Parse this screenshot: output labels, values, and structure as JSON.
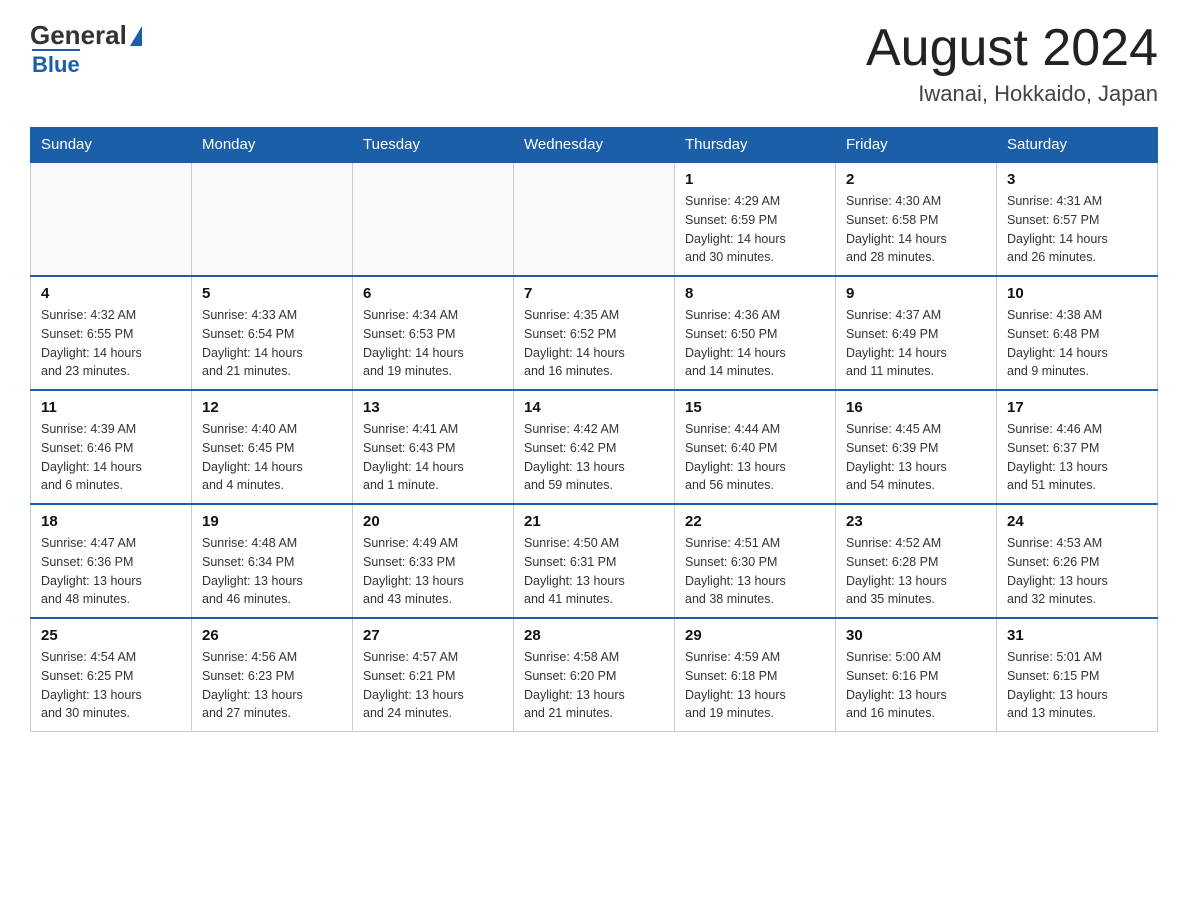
{
  "logo": {
    "general": "General",
    "arrow": "▶",
    "blue": "Blue"
  },
  "header": {
    "title": "August 2024",
    "subtitle": "Iwanai, Hokkaido, Japan"
  },
  "weekdays": [
    "Sunday",
    "Monday",
    "Tuesday",
    "Wednesday",
    "Thursday",
    "Friday",
    "Saturday"
  ],
  "weeks": [
    [
      {
        "day": "",
        "info": ""
      },
      {
        "day": "",
        "info": ""
      },
      {
        "day": "",
        "info": ""
      },
      {
        "day": "",
        "info": ""
      },
      {
        "day": "1",
        "info": "Sunrise: 4:29 AM\nSunset: 6:59 PM\nDaylight: 14 hours\nand 30 minutes."
      },
      {
        "day": "2",
        "info": "Sunrise: 4:30 AM\nSunset: 6:58 PM\nDaylight: 14 hours\nand 28 minutes."
      },
      {
        "day": "3",
        "info": "Sunrise: 4:31 AM\nSunset: 6:57 PM\nDaylight: 14 hours\nand 26 minutes."
      }
    ],
    [
      {
        "day": "4",
        "info": "Sunrise: 4:32 AM\nSunset: 6:55 PM\nDaylight: 14 hours\nand 23 minutes."
      },
      {
        "day": "5",
        "info": "Sunrise: 4:33 AM\nSunset: 6:54 PM\nDaylight: 14 hours\nand 21 minutes."
      },
      {
        "day": "6",
        "info": "Sunrise: 4:34 AM\nSunset: 6:53 PM\nDaylight: 14 hours\nand 19 minutes."
      },
      {
        "day": "7",
        "info": "Sunrise: 4:35 AM\nSunset: 6:52 PM\nDaylight: 14 hours\nand 16 minutes."
      },
      {
        "day": "8",
        "info": "Sunrise: 4:36 AM\nSunset: 6:50 PM\nDaylight: 14 hours\nand 14 minutes."
      },
      {
        "day": "9",
        "info": "Sunrise: 4:37 AM\nSunset: 6:49 PM\nDaylight: 14 hours\nand 11 minutes."
      },
      {
        "day": "10",
        "info": "Sunrise: 4:38 AM\nSunset: 6:48 PM\nDaylight: 14 hours\nand 9 minutes."
      }
    ],
    [
      {
        "day": "11",
        "info": "Sunrise: 4:39 AM\nSunset: 6:46 PM\nDaylight: 14 hours\nand 6 minutes."
      },
      {
        "day": "12",
        "info": "Sunrise: 4:40 AM\nSunset: 6:45 PM\nDaylight: 14 hours\nand 4 minutes."
      },
      {
        "day": "13",
        "info": "Sunrise: 4:41 AM\nSunset: 6:43 PM\nDaylight: 14 hours\nand 1 minute."
      },
      {
        "day": "14",
        "info": "Sunrise: 4:42 AM\nSunset: 6:42 PM\nDaylight: 13 hours\nand 59 minutes."
      },
      {
        "day": "15",
        "info": "Sunrise: 4:44 AM\nSunset: 6:40 PM\nDaylight: 13 hours\nand 56 minutes."
      },
      {
        "day": "16",
        "info": "Sunrise: 4:45 AM\nSunset: 6:39 PM\nDaylight: 13 hours\nand 54 minutes."
      },
      {
        "day": "17",
        "info": "Sunrise: 4:46 AM\nSunset: 6:37 PM\nDaylight: 13 hours\nand 51 minutes."
      }
    ],
    [
      {
        "day": "18",
        "info": "Sunrise: 4:47 AM\nSunset: 6:36 PM\nDaylight: 13 hours\nand 48 minutes."
      },
      {
        "day": "19",
        "info": "Sunrise: 4:48 AM\nSunset: 6:34 PM\nDaylight: 13 hours\nand 46 minutes."
      },
      {
        "day": "20",
        "info": "Sunrise: 4:49 AM\nSunset: 6:33 PM\nDaylight: 13 hours\nand 43 minutes."
      },
      {
        "day": "21",
        "info": "Sunrise: 4:50 AM\nSunset: 6:31 PM\nDaylight: 13 hours\nand 41 minutes."
      },
      {
        "day": "22",
        "info": "Sunrise: 4:51 AM\nSunset: 6:30 PM\nDaylight: 13 hours\nand 38 minutes."
      },
      {
        "day": "23",
        "info": "Sunrise: 4:52 AM\nSunset: 6:28 PM\nDaylight: 13 hours\nand 35 minutes."
      },
      {
        "day": "24",
        "info": "Sunrise: 4:53 AM\nSunset: 6:26 PM\nDaylight: 13 hours\nand 32 minutes."
      }
    ],
    [
      {
        "day": "25",
        "info": "Sunrise: 4:54 AM\nSunset: 6:25 PM\nDaylight: 13 hours\nand 30 minutes."
      },
      {
        "day": "26",
        "info": "Sunrise: 4:56 AM\nSunset: 6:23 PM\nDaylight: 13 hours\nand 27 minutes."
      },
      {
        "day": "27",
        "info": "Sunrise: 4:57 AM\nSunset: 6:21 PM\nDaylight: 13 hours\nand 24 minutes."
      },
      {
        "day": "28",
        "info": "Sunrise: 4:58 AM\nSunset: 6:20 PM\nDaylight: 13 hours\nand 21 minutes."
      },
      {
        "day": "29",
        "info": "Sunrise: 4:59 AM\nSunset: 6:18 PM\nDaylight: 13 hours\nand 19 minutes."
      },
      {
        "day": "30",
        "info": "Sunrise: 5:00 AM\nSunset: 6:16 PM\nDaylight: 13 hours\nand 16 minutes."
      },
      {
        "day": "31",
        "info": "Sunrise: 5:01 AM\nSunset: 6:15 PM\nDaylight: 13 hours\nand 13 minutes."
      }
    ]
  ]
}
